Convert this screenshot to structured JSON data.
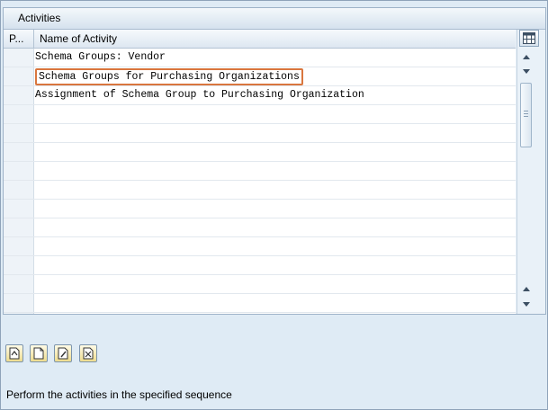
{
  "panel": {
    "title": "Activities"
  },
  "table": {
    "columns": [
      "P...",
      "Name of Activity"
    ],
    "rows": [
      "Schema Groups: Vendor",
      "Schema Groups for Purchasing Organizations",
      "Assignment of Schema Group to Purchasing Organization",
      "",
      "",
      "",
      "",
      "",
      "",
      "",
      "",
      "",
      "",
      "",
      ""
    ],
    "selected_row_index": 1
  },
  "toolbar": {
    "buttons": [
      {
        "icon": "choose-activity-icon"
      },
      {
        "icon": "create-icon"
      },
      {
        "icon": "change-icon"
      },
      {
        "icon": "delete-icon"
      }
    ]
  },
  "status": {
    "text": "Perform the activities in the specified sequence"
  },
  "colors": {
    "selection_border": "#d9763e",
    "background": "#dfebf5"
  }
}
